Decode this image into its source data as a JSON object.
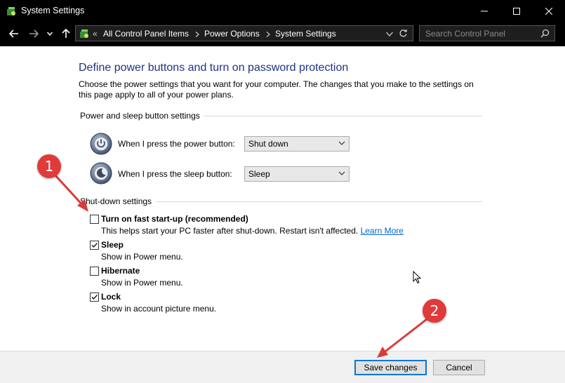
{
  "window": {
    "title": "System Settings",
    "controls": [
      "minimize-icon",
      "maximize-icon",
      "close-icon"
    ]
  },
  "nav": {
    "breadcrumb_prefix": "«",
    "breadcrumbs": [
      "All Control Panel Items",
      "Power Options",
      "System Settings"
    ],
    "search_placeholder": "Search Control Panel"
  },
  "page": {
    "heading": "Define power buttons and turn on password protection",
    "description": "Choose the power settings that you want for your computer. The changes that you make to the settings on this page apply to all of your power plans."
  },
  "power_section": {
    "title": "Power and sleep button settings",
    "power_button": {
      "label": "When I press the power button:",
      "value": "Shut down"
    },
    "sleep_button": {
      "label": "When I press the sleep button:",
      "value": "Sleep"
    }
  },
  "shutdown_section": {
    "title": "Shut-down settings",
    "options": [
      {
        "title": "Turn on fast start-up (recommended)",
        "desc": "This helps start your PC faster after shut-down. Restart isn't affected.",
        "link": "Learn More",
        "checked": false
      },
      {
        "title": "Sleep",
        "desc": "Show in Power menu.",
        "checked": true
      },
      {
        "title": "Hibernate",
        "desc": "Show in Power menu.",
        "checked": false
      },
      {
        "title": "Lock",
        "desc": "Show in account picture menu.",
        "checked": true
      }
    ]
  },
  "footer": {
    "save_label": "Save changes",
    "cancel_label": "Cancel"
  },
  "annotations": [
    "1",
    "2"
  ],
  "colors": {
    "heading": "#1e3287",
    "link": "#0066cc",
    "marker": "#e03a3a",
    "titlebar": "#000000"
  }
}
